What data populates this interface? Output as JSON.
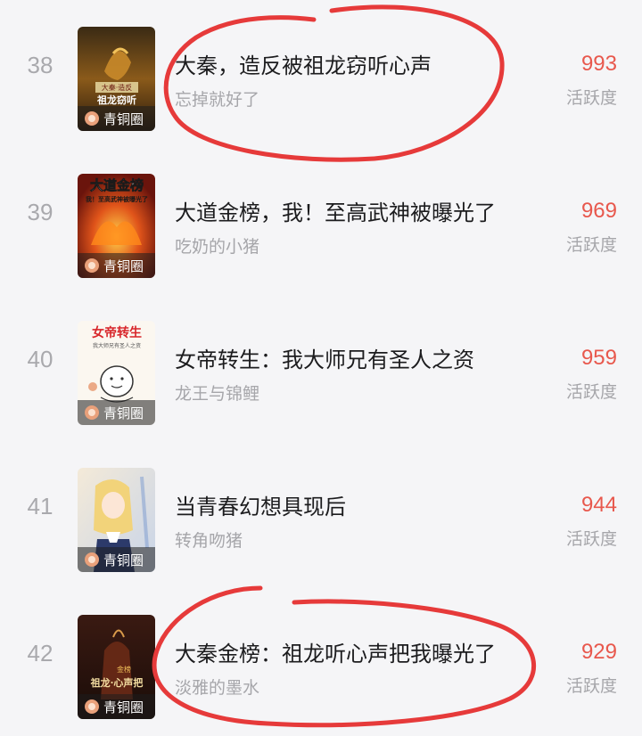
{
  "rows": [
    {
      "rank": "38",
      "title": "大秦，造反被祖龙窃听心声",
      "author": "忘掉就好了",
      "score": "993",
      "score_label": "活跃度",
      "cover_tag": "青铜圈"
    },
    {
      "rank": "39",
      "title": "大道金榜，我！至高武神被曝光了",
      "author": "吃奶的小猪",
      "score": "969",
      "score_label": "活跃度",
      "cover_tag": "青铜圈"
    },
    {
      "rank": "40",
      "title": "女帝转生：我大师兄有圣人之资",
      "author": "龙王与锦鲤",
      "score": "959",
      "score_label": "活跃度",
      "cover_tag": "青铜圈"
    },
    {
      "rank": "41",
      "title": "当青春幻想具现后",
      "author": "转角吻猪",
      "score": "944",
      "score_label": "活跃度",
      "cover_tag": "青铜圈"
    },
    {
      "rank": "42",
      "title": "大秦金榜：祖龙听心声把我曝光了",
      "author": "淡雅的墨水",
      "score": "929",
      "score_label": "活跃度",
      "cover_tag": "青铜圈"
    }
  ],
  "covers": [
    {
      "lines": [
        "大秦·造反",
        "祖龙窃听"
      ]
    },
    {
      "lines": [
        "大道金榜",
        "我！至高武神被曝光了"
      ]
    },
    {
      "lines": [
        "女帝转生",
        "我大师兄有圣人之资"
      ]
    },
    {
      "lines": []
    },
    {
      "lines": [
        "金榜",
        "祖龙·心声把"
      ]
    }
  ],
  "colors": {
    "score": "#e8584d",
    "annotation": "#e63a3a",
    "background": "#f5f5f7"
  }
}
